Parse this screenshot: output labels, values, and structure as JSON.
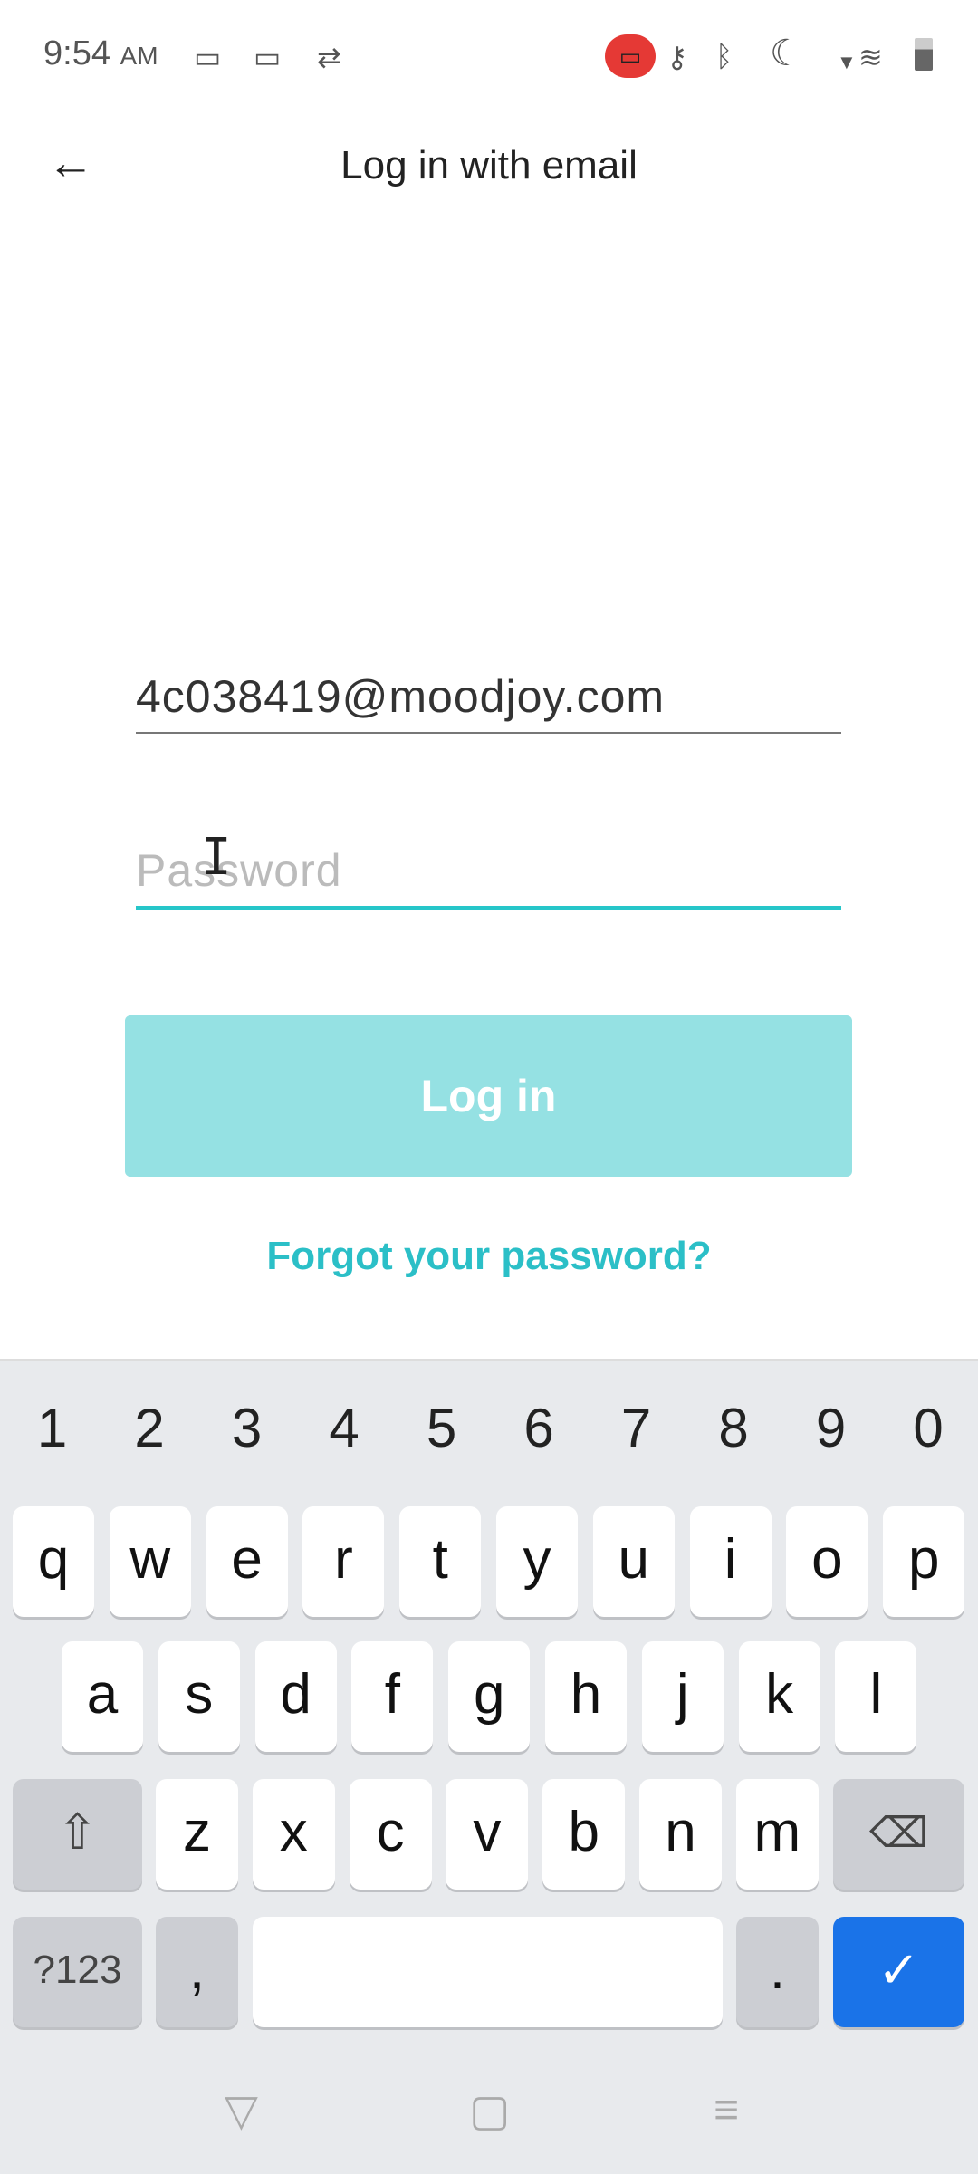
{
  "status_bar": {
    "time": "9:54",
    "ampm": "AM",
    "icons_left": [
      "screen-record-icon",
      "screen-record-icon",
      "sync-icon"
    ],
    "icons_right": [
      "recording-icon",
      "vpn-key-icon",
      "bluetooth-icon",
      "do-not-disturb-moon-icon",
      "wifi-icon",
      "battery-icon"
    ]
  },
  "header": {
    "title": "Log in with email",
    "back_icon": "arrow-left-icon"
  },
  "form": {
    "email_value": "4c038419@moodjoy.com",
    "password_placeholder": "Password",
    "login_label": "Log in",
    "forgot_label": "Forgot your password?"
  },
  "colors": {
    "accent": "#26c6c9",
    "button_disabled": "#95e1e3",
    "link": "#2bbfc7",
    "enter_key": "#1a73e8"
  },
  "keyboard": {
    "numbers": [
      "1",
      "2",
      "3",
      "4",
      "5",
      "6",
      "7",
      "8",
      "9",
      "0"
    ],
    "row1": [
      "q",
      "w",
      "e",
      "r",
      "t",
      "y",
      "u",
      "i",
      "o",
      "p"
    ],
    "row2": [
      "a",
      "s",
      "d",
      "f",
      "g",
      "h",
      "j",
      "k",
      "l"
    ],
    "row3": [
      "z",
      "x",
      "c",
      "v",
      "b",
      "n",
      "m"
    ],
    "symbols_label": "?123",
    "comma": ",",
    "period": "."
  }
}
